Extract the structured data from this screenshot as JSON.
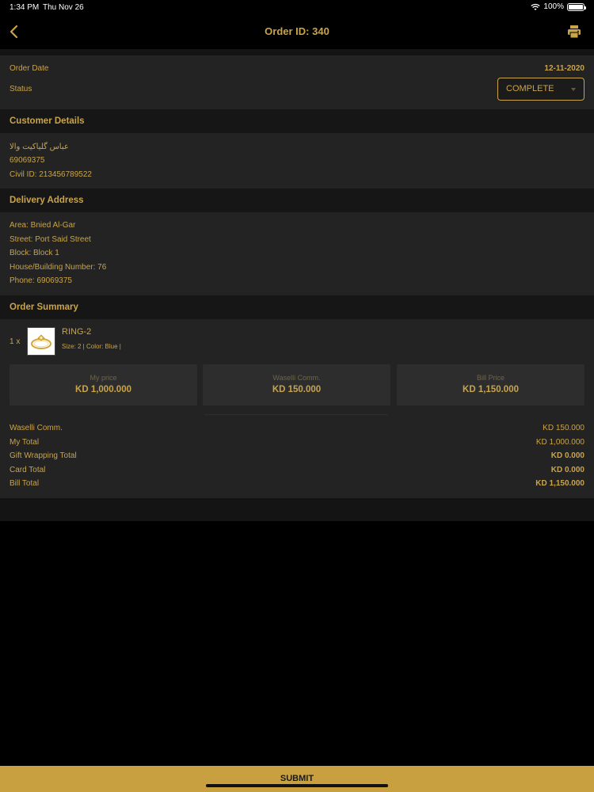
{
  "status_bar": {
    "time": "1:34 PM",
    "date": "Thu Nov 26",
    "battery": "100%"
  },
  "nav": {
    "title": "Order ID: 340",
    "back_icon": "chevron-left-icon",
    "print_icon": "printer-icon"
  },
  "order": {
    "date_label": "Order Date",
    "date_value": "12-11-2020",
    "status_label": "Status",
    "status_value": "COMPLETE"
  },
  "customer": {
    "header": "Customer Details",
    "name": "عباس گلیاکیت والا",
    "phone": "69069375",
    "civil_id": "Civil ID: 213456789522"
  },
  "delivery": {
    "header": "Delivery Address",
    "area": "Area: Bnied Al-Gar",
    "street": "Street: Port Said Street",
    "block": "Block: Block 1",
    "house": "House/Building Number: 76",
    "phone": "Phone: 69069375"
  },
  "summary": {
    "header": "Order Summary",
    "item": {
      "qty": "1 x",
      "name": "RING-2",
      "details": "Size: 2 | Color: Blue |"
    },
    "cards": [
      {
        "title": "My price",
        "value": "KD 1,000.000"
      },
      {
        "title": "Waselli Comm.",
        "value": "KD 150.000"
      },
      {
        "title": "Bill Price",
        "value": "KD 1,150.000"
      }
    ],
    "totals": [
      {
        "label": "Waselli Comm.",
        "value": "KD 150.000"
      },
      {
        "label": "My Total",
        "value": "KD 1,000.000"
      },
      {
        "label": "Gift Wrapping Total",
        "value": "KD 0.000"
      },
      {
        "label": "Card Total",
        "value": "KD 0.000"
      },
      {
        "label": "Bill Total",
        "value": "KD 1,150.000"
      }
    ]
  },
  "submit_label": "SUBMIT",
  "colors": {
    "accent": "#c9a44a",
    "background": "#000000",
    "panel": "#232323",
    "header": "#161616",
    "submit": "#c9a040"
  }
}
